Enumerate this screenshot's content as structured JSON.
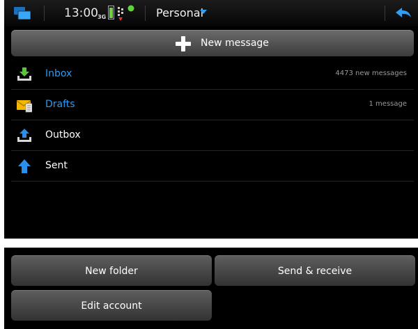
{
  "status_bar": {
    "time": "13:00",
    "network": "3G",
    "menu_title": "Personal"
  },
  "new_message": {
    "label": "New message"
  },
  "folders": [
    {
      "name": "Inbox",
      "count": "4473 new messages",
      "icon": "inbox-download-icon"
    },
    {
      "name": "Drafts",
      "count": "1 message",
      "icon": "envelope-icon"
    },
    {
      "name": "Outbox",
      "count": "",
      "icon": "outbox-upload-icon"
    },
    {
      "name": "Sent",
      "count": "",
      "icon": "up-arrow-icon"
    }
  ],
  "menu": {
    "new_folder": "New folder",
    "send_receive": "Send & receive",
    "edit_account": "Edit account"
  },
  "colors": {
    "accent": "#2a9bf2",
    "background": "#000000",
    "button": "#4a4a4a",
    "battery": "#6cd43a"
  }
}
